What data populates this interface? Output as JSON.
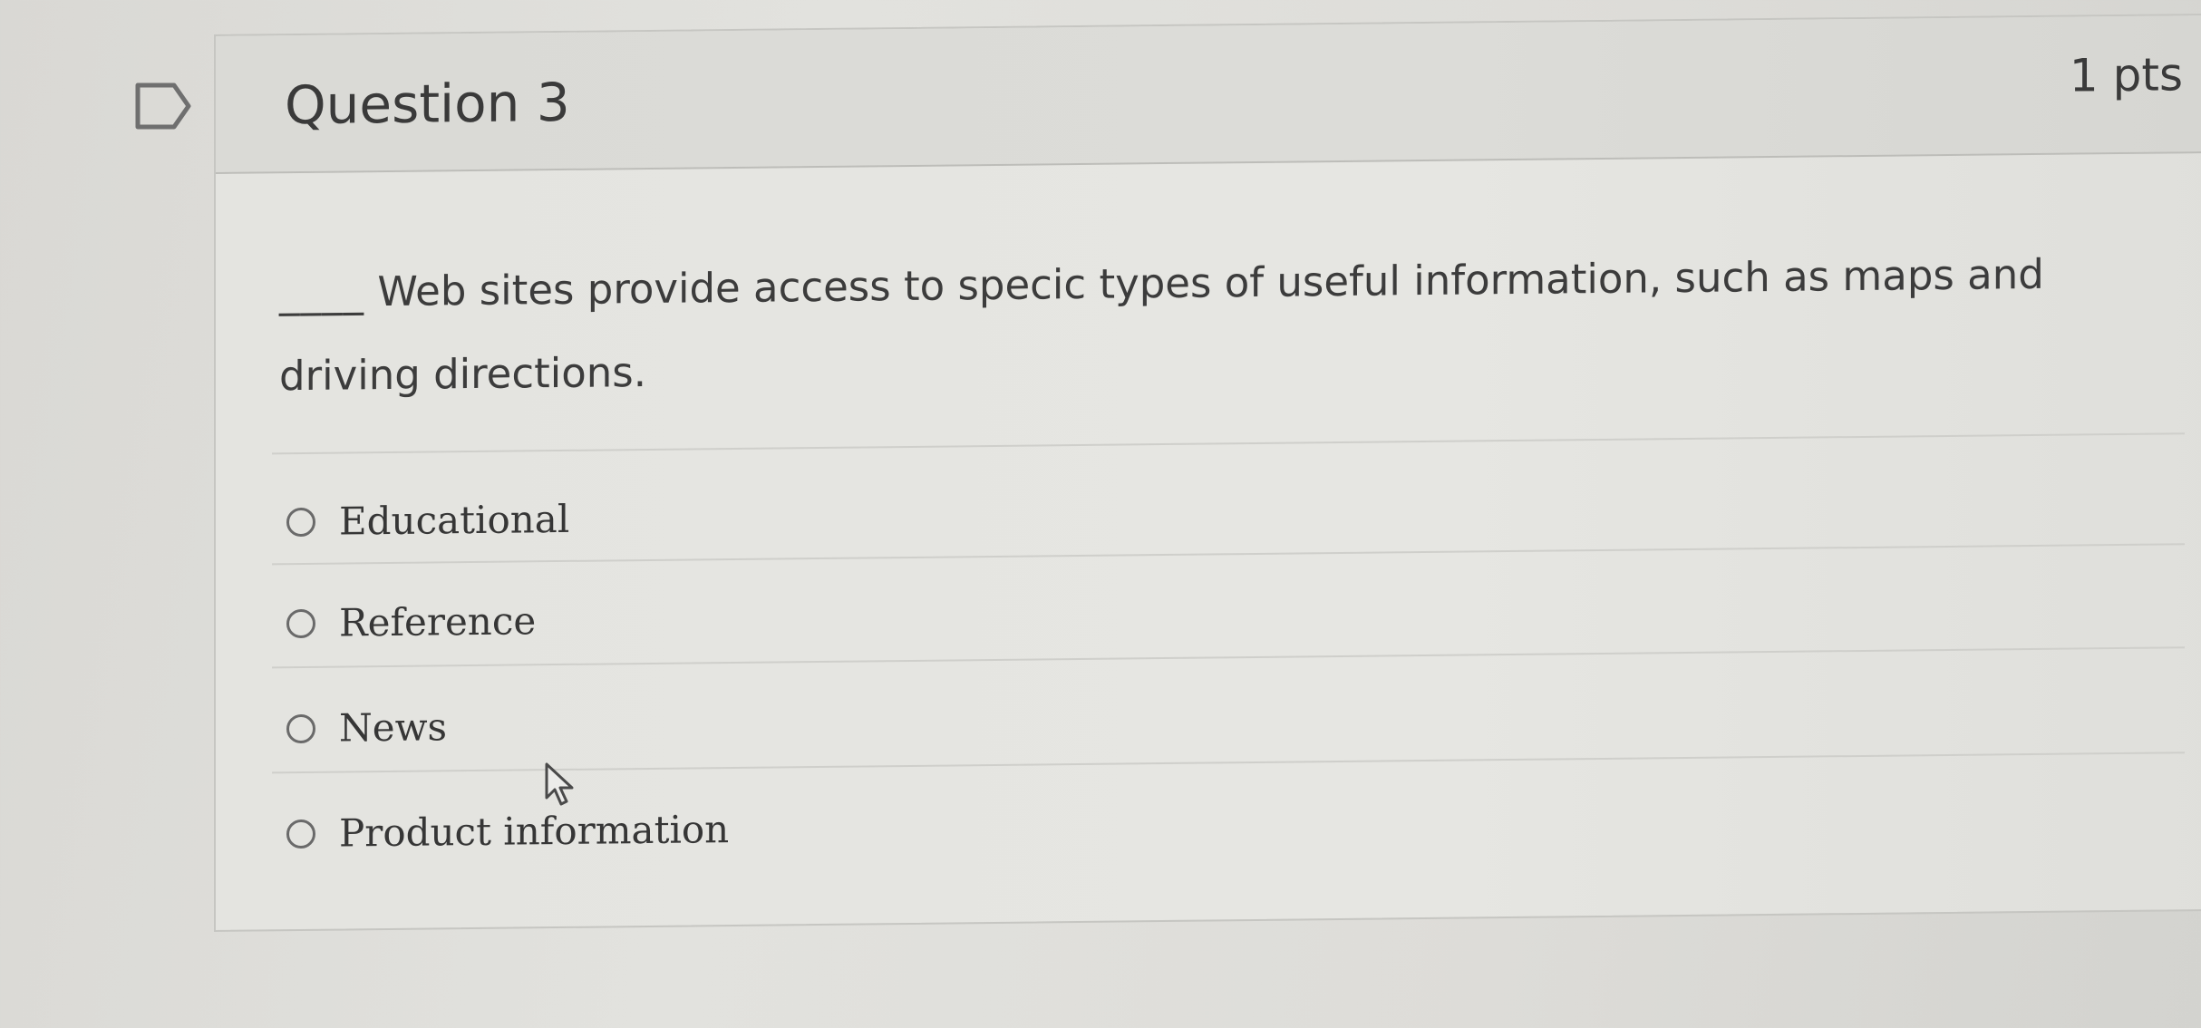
{
  "question": {
    "title": "Question 3",
    "points": "1 pts",
    "blank": "____",
    "text": "Web sites provide access to specic types of useful information, such as maps and driving directions."
  },
  "answers": [
    {
      "label": "Educational",
      "selected": false
    },
    {
      "label": "Reference",
      "selected": false
    },
    {
      "label": "News",
      "selected": false
    },
    {
      "label": "Product information",
      "selected": false
    }
  ],
  "icons": {
    "flag": "flag-bookmark-icon",
    "cursor": "mouse-pointer-icon"
  },
  "colors": {
    "text": "#3a3a3a",
    "border": "#c6c6c2",
    "header_bg": "#dadad6",
    "body_bg": "#e4e4e0"
  }
}
